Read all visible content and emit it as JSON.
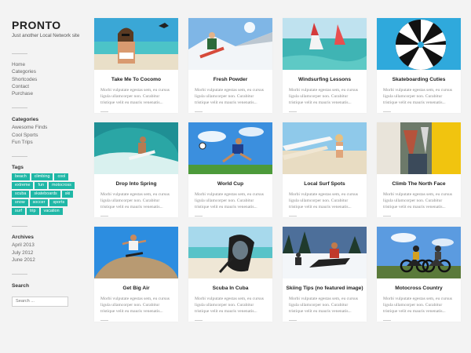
{
  "site": {
    "title": "PRONTO",
    "tagline": "Just another Local Network site"
  },
  "menu": [
    "Home",
    "Categories",
    "Shortcodes",
    "Contact",
    "Purchase"
  ],
  "categories": {
    "title": "Categories",
    "items": [
      "Awesome Finds",
      "Cool Sports",
      "Fun Trips"
    ]
  },
  "tags": {
    "title": "Tags",
    "items": [
      "beach",
      "climbing",
      "cool",
      "extreme",
      "fun",
      "motocross",
      "scuba",
      "skateboards",
      "ski",
      "snow",
      "soccer",
      "sports",
      "surf",
      "trip",
      "vacation"
    ]
  },
  "archives": {
    "title": "Archives",
    "items": [
      "April 2013",
      "July 2012",
      "June 2012"
    ]
  },
  "search": {
    "title": "Search",
    "placeholder": "Search ..."
  },
  "excerpt": {
    "line1": "Morbi vulputate egestas sem, eu cursus",
    "line2": "ligula ullamcorper non. Curabitur",
    "line3": "tristique velit eu mauris venenatis..."
  },
  "posts": [
    {
      "title": "Take Me To Cocomo",
      "image": "woman-sunglasses-beach"
    },
    {
      "title": "Fresh Powder",
      "image": "snowboarder-jump"
    },
    {
      "title": "Windsurfing Lessons",
      "image": "windsurfers-sea"
    },
    {
      "title": "Skateboarding Cuties",
      "image": "striped-umbrella"
    },
    {
      "title": "Drop Into Spring",
      "image": "surfer-wave"
    },
    {
      "title": "World Cup",
      "image": "soccer-kick"
    },
    {
      "title": "Local Surf Spots",
      "image": "surfboards-woman"
    },
    {
      "title": "Climb The North Face",
      "image": "climber-gear"
    },
    {
      "title": "Get Big Air",
      "image": "skater-air"
    },
    {
      "title": "Scuba In Cuba",
      "image": "scuba-mask-beach"
    },
    {
      "title": "Skiing Tips (no featured image)",
      "image": "snowmobile-riders"
    },
    {
      "title": "Motocross Country",
      "image": "motocross-bikes"
    }
  ]
}
